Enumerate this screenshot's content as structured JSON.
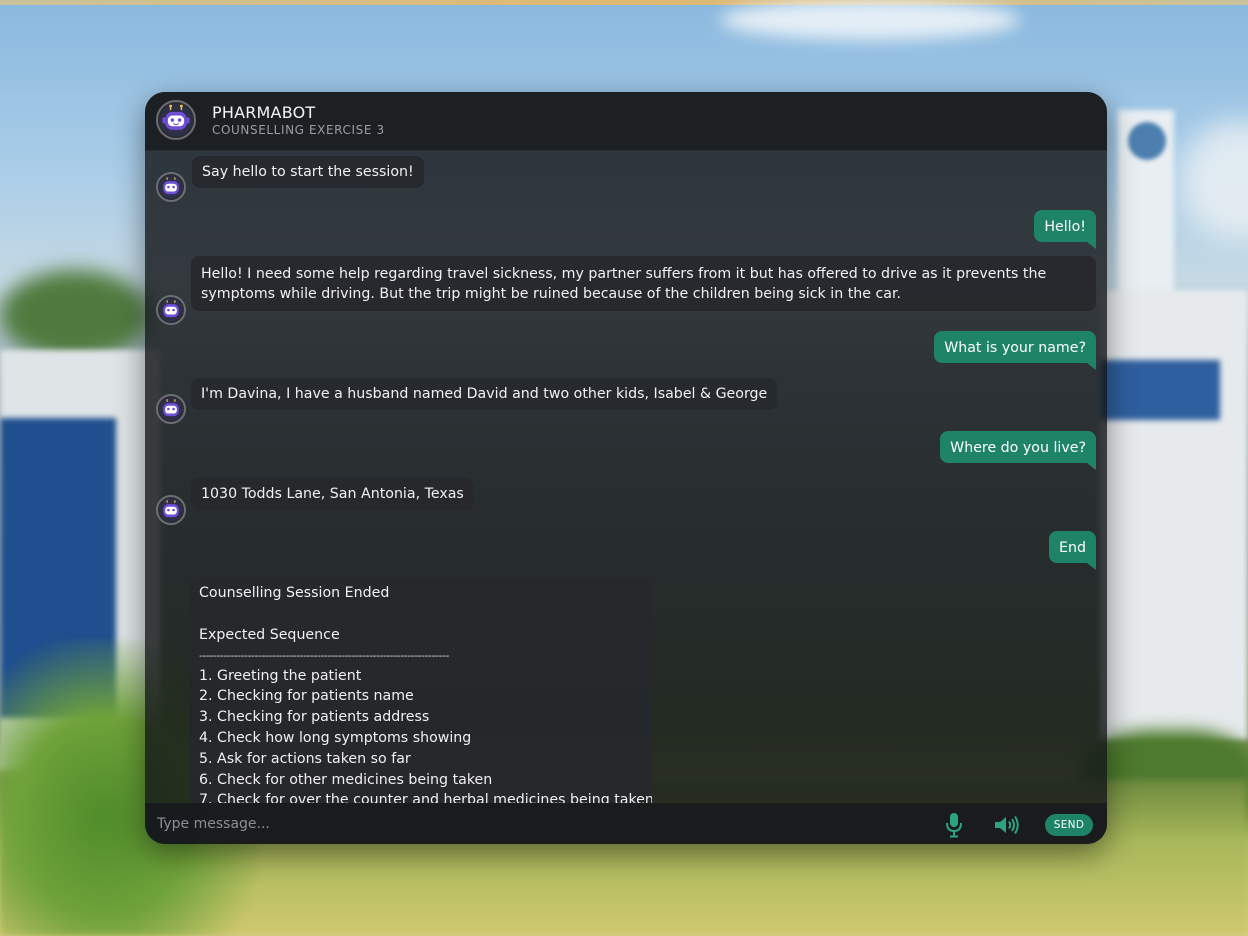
{
  "header": {
    "title": "PHARMABOT",
    "subtitle": "COUNSELLING EXERCISE 3",
    "avatar_icon": "robot-icon"
  },
  "messages": [
    {
      "sender": "bot",
      "text": "Say hello to start the session!"
    },
    {
      "sender": "user",
      "text": "Hello!"
    },
    {
      "sender": "bot",
      "text": "Hello! I need some help regarding travel sickness, my partner suffers from it but has offered to drive as it prevents the symptoms while driving. But the trip might be ruined because of the children being sick in the car."
    },
    {
      "sender": "user",
      "text": "What is your name?"
    },
    {
      "sender": "bot",
      "text": "I'm Davina, I have a husband named David and two other kids, Isabel & George"
    },
    {
      "sender": "user",
      "text": "Where do you live?"
    },
    {
      "sender": "bot",
      "text": "1030 Todds Lane, San Antonia, Texas"
    },
    {
      "sender": "user",
      "text": "End"
    }
  ],
  "summary": {
    "title": "Counselling Session Ended",
    "heading": "Expected Sequence",
    "rule": "------------------------------------------------------------------------",
    "items": [
      "1. Greeting the patient",
      "2. Checking for patients name",
      "3. Checking for patients address",
      "4. Check how long symptoms showing",
      "5. Ask for actions taken so far",
      "6. Check for other medicines being taken",
      "7. Check for over the counter and herbal medicines being taken"
    ]
  },
  "input": {
    "placeholder": "Type message...",
    "value": ""
  },
  "controls": {
    "send_label": "SEND",
    "mic_icon": "microphone-icon",
    "speaker_icon": "speaker-icon"
  },
  "colors": {
    "user_bubble": "#1f8467",
    "bot_bubble": "#26282c",
    "panel": "#141619",
    "send_button": "#1f8467",
    "icon_accent": "#2ba57f"
  }
}
